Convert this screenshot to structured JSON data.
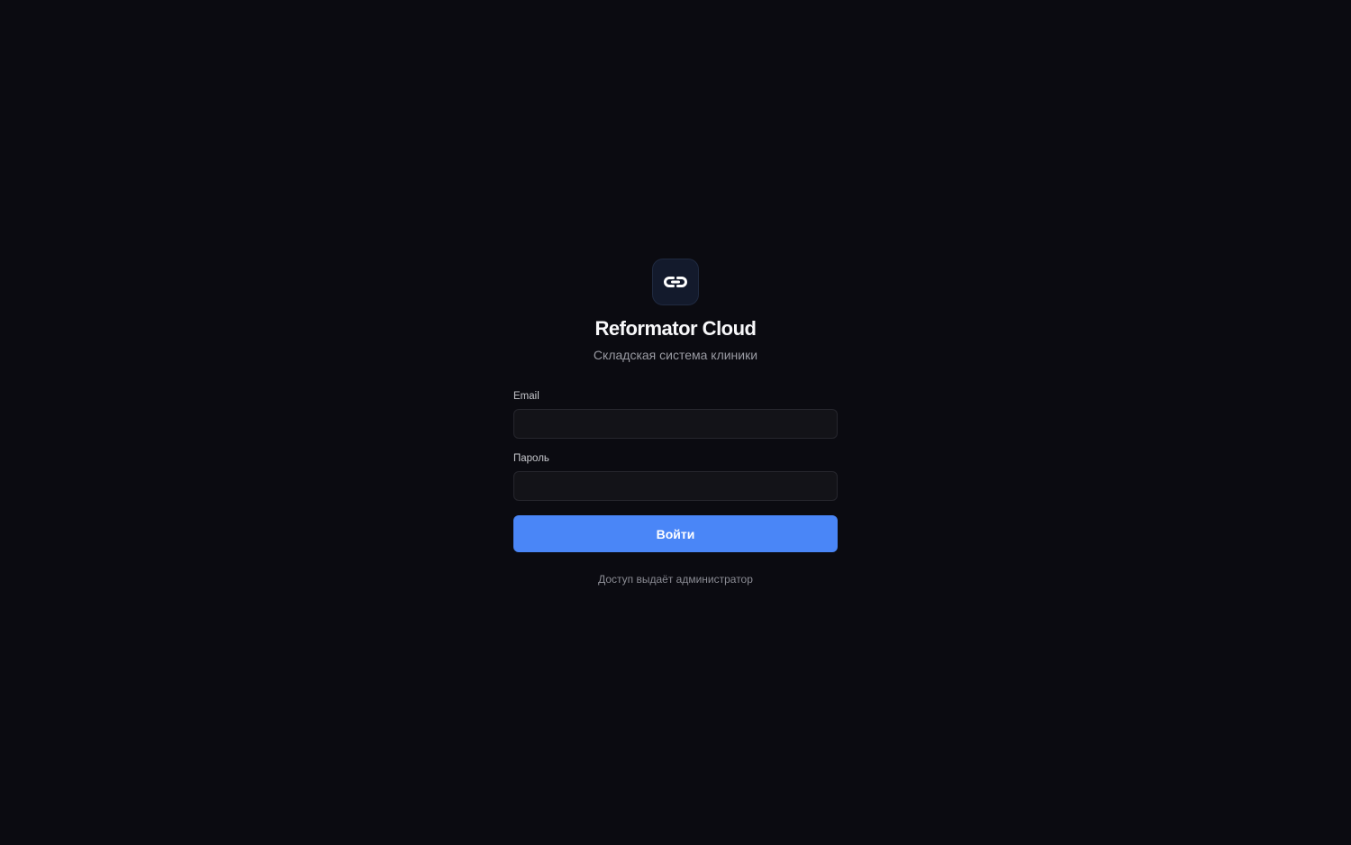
{
  "app": {
    "title": "Reformator Cloud",
    "subtitle": "Складская система клиники",
    "logo_icon": "link-icon"
  },
  "login_form": {
    "email_label": "Email",
    "email_value": "",
    "email_placeholder": "",
    "password_label": "Пароль",
    "password_value": "",
    "password_placeholder": "",
    "submit_label": "Войти"
  },
  "footer": {
    "note": "Доступ выдаёт администратор"
  },
  "colors": {
    "background": "#0b0b11",
    "accent": "#4a86f7",
    "input_background": "#131318",
    "logo_background": "#131a2c"
  }
}
